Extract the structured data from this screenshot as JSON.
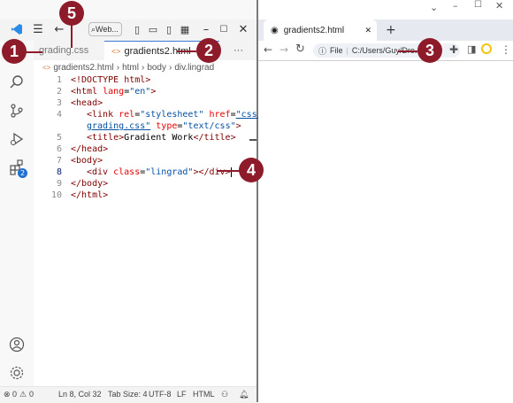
{
  "vscode": {
    "command_center": "Web...",
    "tabs": [
      {
        "label": "grading.css",
        "active": false
      },
      {
        "label": "gradients2.html",
        "active": true
      }
    ],
    "more_tabs": "···",
    "breadcrumb": [
      "gradients2.html",
      "html",
      "body",
      "div.lingrad"
    ],
    "line_numbers": [
      "1",
      "2",
      "3",
      "4",
      "",
      "5",
      "6",
      "7",
      "8",
      "9",
      "10"
    ],
    "code": {
      "l1": "<!DOCTYPE html>",
      "l2_open": "<html ",
      "l2_attr": "lang",
      "l2_eq": "=",
      "l2_val": "\"en\"",
      "l2_close": ">",
      "l3": "<head>",
      "l4_tag": "<link ",
      "l4_attr1": "rel",
      "l4_val1": "\"stylesheet\"",
      "l4_attr2": "href",
      "l4_val2": "\"css/",
      "l4b_val": "grading.css\"",
      "l4b_attr": "type",
      "l4b_val2": "\"text/css\"",
      "l4b_close": ">",
      "l5_tag": "<title>",
      "l5_text": "Gradient Work",
      "l5_end": "</title>",
      "l6": "</head>",
      "l7": "<body>",
      "l8_tag": "<div ",
      "l8_attr": "class",
      "l8_val": "\"lingrad\"",
      "l8_end": "></div>",
      "l9": "</body>",
      "l10": "</html>"
    },
    "status": {
      "errors": "0",
      "warnings": "0",
      "position": "Ln 8, Col 32",
      "tab_size": "Tab Size: 4",
      "encoding": "UTF-8",
      "eol": "LF",
      "language": "HTML"
    },
    "badge": "2"
  },
  "browser": {
    "tab_title": "gradients2.html",
    "new_tab": "+",
    "address_label": "File",
    "address": "C:/Users/Guy/Dro..."
  },
  "callouts": [
    "1",
    "2",
    "3",
    "4",
    "5"
  ],
  "colors": {
    "callout": "#8e1b2a",
    "vscode_logo": "#2a8ce6"
  }
}
